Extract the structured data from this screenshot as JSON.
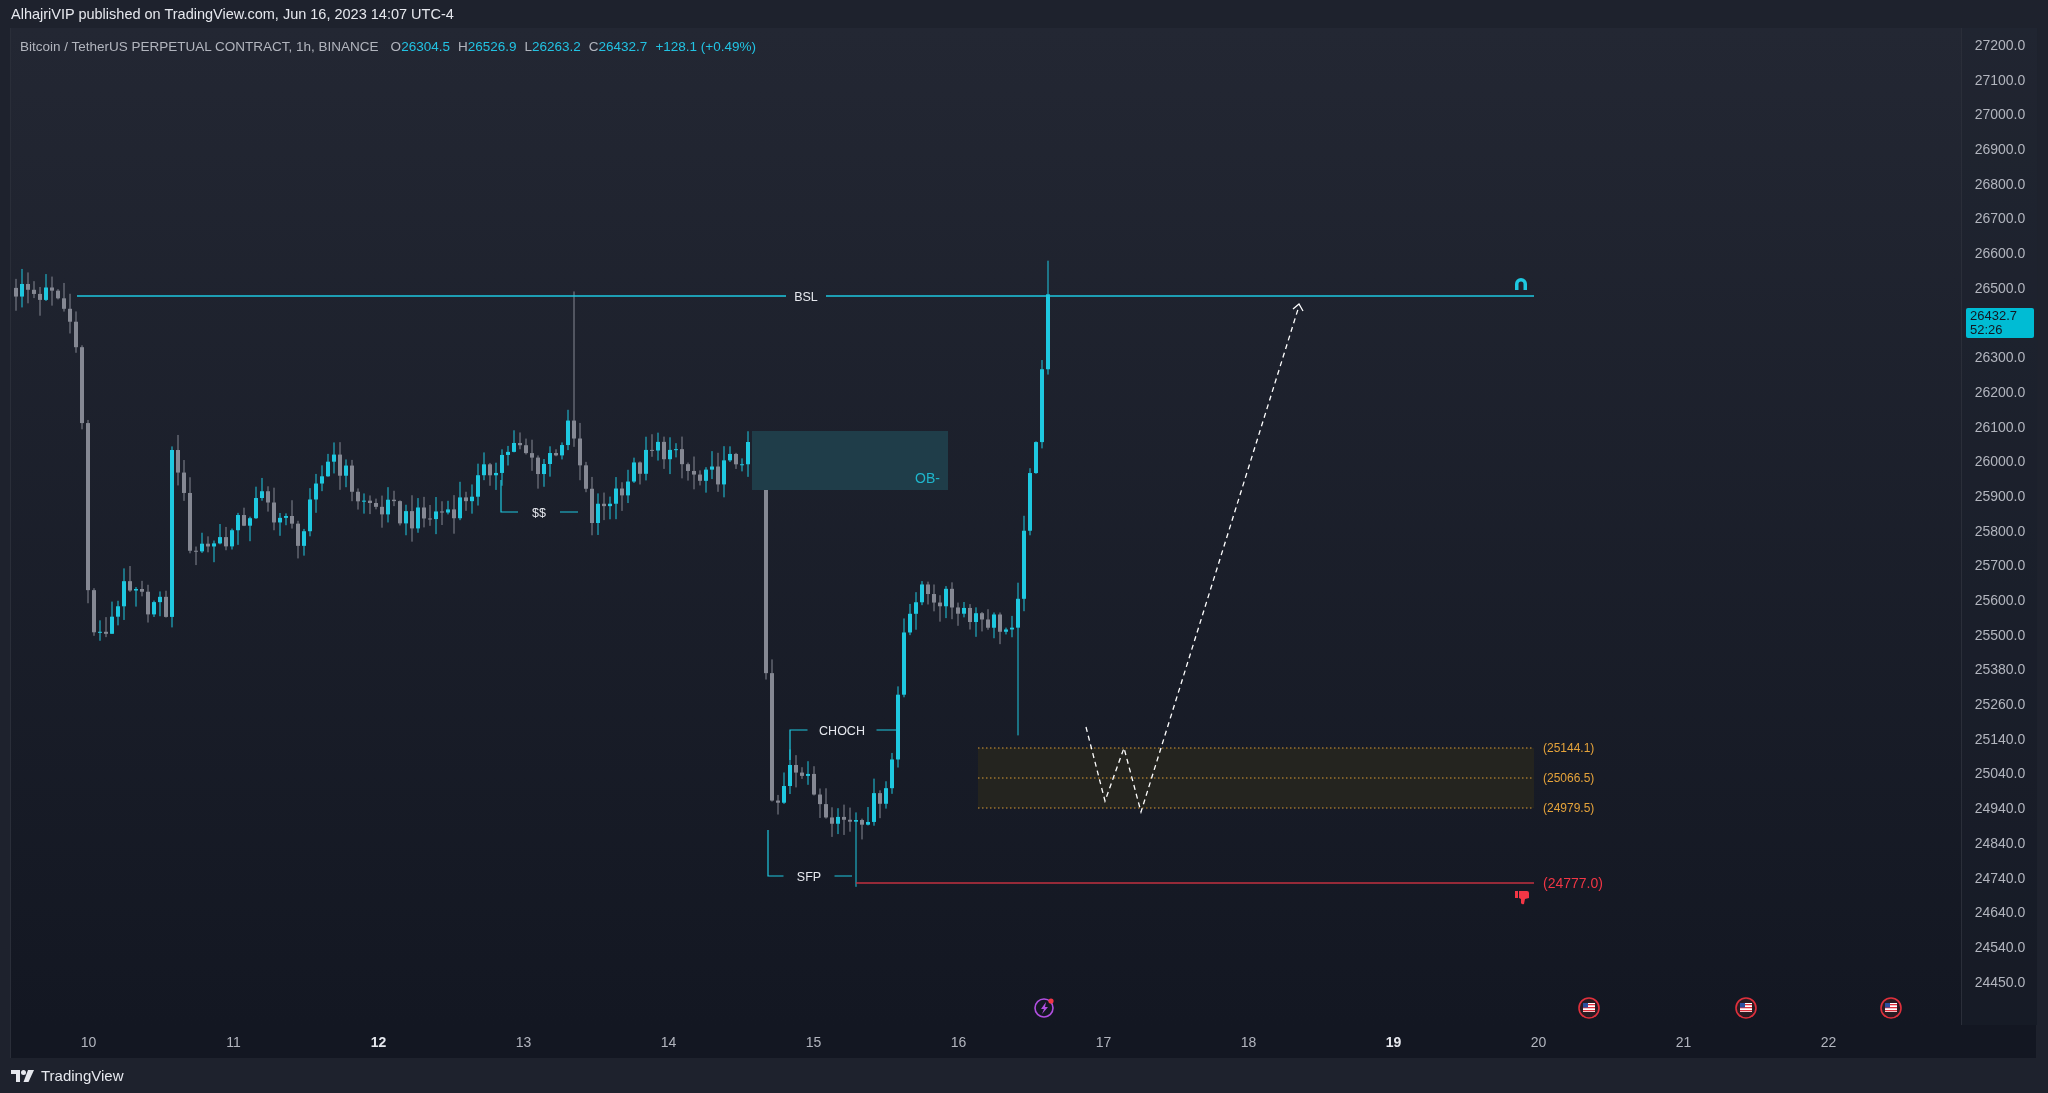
{
  "header": {
    "published": "AlhajriVIP published on TradingView.com, Jun 16, 2023 14:07 UTC-4"
  },
  "chart": {
    "legend": {
      "symbol": "Bitcoin / TetherUS PERPETUAL CONTRACT, 1h, BINANCE",
      "ohlc": [
        {
          "label": "O",
          "value": "26304.5"
        },
        {
          "label": "H",
          "value": "26526.9"
        },
        {
          "label": "L",
          "value": "26263.2"
        },
        {
          "label": "C",
          "value": "26432.7"
        }
      ],
      "change": "+128.1 (+0.49%)"
    },
    "annotations": [
      {
        "kind": "level",
        "label": "BSL"
      },
      {
        "kind": "order_block",
        "label": "OB-"
      },
      {
        "kind": "bracket",
        "label": "$$"
      },
      {
        "kind": "bracket",
        "label": "CHOCH"
      },
      {
        "kind": "bracket",
        "label": "SFP"
      }
    ],
    "target_zone": {
      "levels": [
        "(25144.1)",
        "(25066.5)",
        "(24979.5)"
      ]
    },
    "stop_level": {
      "label": "(24777.0)"
    }
  },
  "price_axis": {
    "items": [
      {
        "kind": "tick",
        "text": "27200.0"
      },
      {
        "kind": "tick",
        "text": "27100.0"
      },
      {
        "kind": "tick",
        "text": "27000.0"
      },
      {
        "kind": "tick",
        "text": "26900.0"
      },
      {
        "kind": "tick",
        "text": "26800.0"
      },
      {
        "kind": "tick",
        "text": "26700.0"
      },
      {
        "kind": "tick",
        "text": "26600.0"
      },
      {
        "kind": "tick",
        "text": "26500.0"
      },
      {
        "kind": "current",
        "price": "26432.7",
        "countdown": "52:26"
      },
      {
        "kind": "tick",
        "text": "26300.0"
      },
      {
        "kind": "tick",
        "text": "26200.0"
      },
      {
        "kind": "tick",
        "text": "26100.0"
      },
      {
        "kind": "tick",
        "text": "26000.0"
      },
      {
        "kind": "tick",
        "text": "25900.0"
      },
      {
        "kind": "tick",
        "text": "25800.0"
      },
      {
        "kind": "tick",
        "text": "25700.0"
      },
      {
        "kind": "tick",
        "text": "25600.0"
      },
      {
        "kind": "tick",
        "text": "25500.0"
      },
      {
        "kind": "tick",
        "text": "25380.0"
      },
      {
        "kind": "tick",
        "text": "25260.0"
      },
      {
        "kind": "tick",
        "text": "25140.0"
      },
      {
        "kind": "tick",
        "text": "25040.0"
      },
      {
        "kind": "tick",
        "text": "24940.0"
      },
      {
        "kind": "tick",
        "text": "24840.0"
      },
      {
        "kind": "tick",
        "text": "24740.0"
      },
      {
        "kind": "tick",
        "text": "24640.0"
      },
      {
        "kind": "tick",
        "text": "24540.0"
      },
      {
        "kind": "tick",
        "text": "24450.0"
      }
    ]
  },
  "time_axis": {
    "labels": [
      {
        "text": "10",
        "emphasized": false
      },
      {
        "text": "11",
        "emphasized": false
      },
      {
        "text": "12",
        "emphasized": true
      },
      {
        "text": "13",
        "emphasized": false
      },
      {
        "text": "14",
        "emphasized": false
      },
      {
        "text": "15",
        "emphasized": false
      },
      {
        "text": "16",
        "emphasized": false
      },
      {
        "text": "17",
        "emphasized": false
      },
      {
        "text": "18",
        "emphasized": false
      },
      {
        "text": "19",
        "emphasized": true
      },
      {
        "text": "20",
        "emphasized": false
      },
      {
        "text": "21",
        "emphasized": false
      },
      {
        "text": "22",
        "emphasized": false
      }
    ]
  },
  "footer": {
    "brand": "TradingView"
  }
}
